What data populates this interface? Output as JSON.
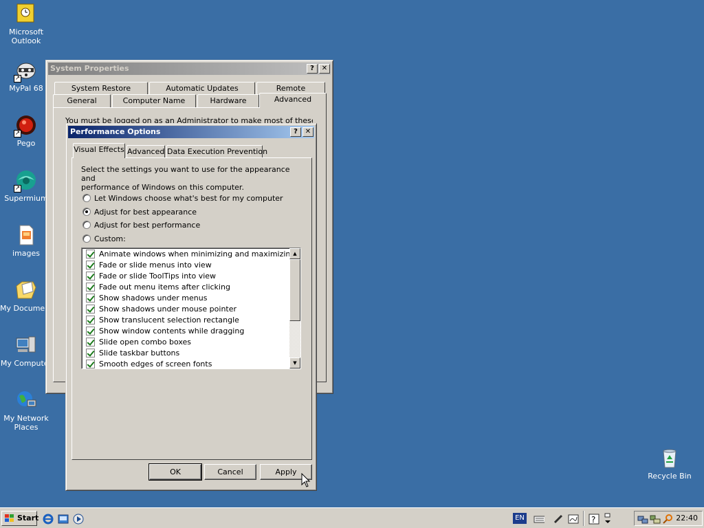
{
  "desktop": {
    "icons": [
      {
        "label": "Microsoft\nOutlook",
        "line1": "Microsoft",
        "line2": "Outlook"
      },
      {
        "line1": "MyPal 68"
      },
      {
        "line1": "Pego"
      },
      {
        "line1": "Supermium"
      },
      {
        "line1": "images"
      },
      {
        "line1": "My Documents"
      },
      {
        "line1": "My Computer"
      },
      {
        "line1": "My Network",
        "line2": "Places"
      },
      {
        "line1": "Recycle Bin"
      }
    ]
  },
  "system_properties": {
    "title": "System Properties",
    "tabs_row1": [
      "System Restore",
      "Automatic Updates",
      "Remote"
    ],
    "tabs_row2": [
      "General",
      "Computer Name",
      "Hardware",
      "Advanced"
    ],
    "notice": "You must be logged on as an Administrator to make most of these changes."
  },
  "performance_options": {
    "title": "Performance Options",
    "tabs": [
      "Visual Effects",
      "Advanced",
      "Data Execution Prevention"
    ],
    "description": "Select the settings you want to use for the appearance and performance of Windows on this computer.",
    "description_line1": "Select the settings you want to use for the appearance and",
    "description_line2": "performance of Windows on this computer.",
    "options": [
      {
        "label": "Let Windows choose what's best for my computer",
        "selected": false
      },
      {
        "label": "Adjust for best appearance",
        "selected": true
      },
      {
        "label": "Adjust for best performance",
        "selected": false
      },
      {
        "label": "Custom:",
        "selected": false
      }
    ],
    "effects": [
      "Animate windows when minimizing and maximizing",
      "Fade or slide menus into view",
      "Fade or slide ToolTips into view",
      "Fade out menu items after clicking",
      "Show shadows under menus",
      "Show shadows under mouse pointer",
      "Show translucent selection rectangle",
      "Show window contents while dragging",
      "Slide open combo boxes",
      "Slide taskbar buttons",
      "Smooth edges of screen fonts"
    ],
    "buttons": {
      "ok": "OK",
      "cancel": "Cancel",
      "apply": "Apply"
    }
  },
  "taskbar": {
    "start": "Start",
    "language": "EN",
    "clock": "22:40"
  }
}
